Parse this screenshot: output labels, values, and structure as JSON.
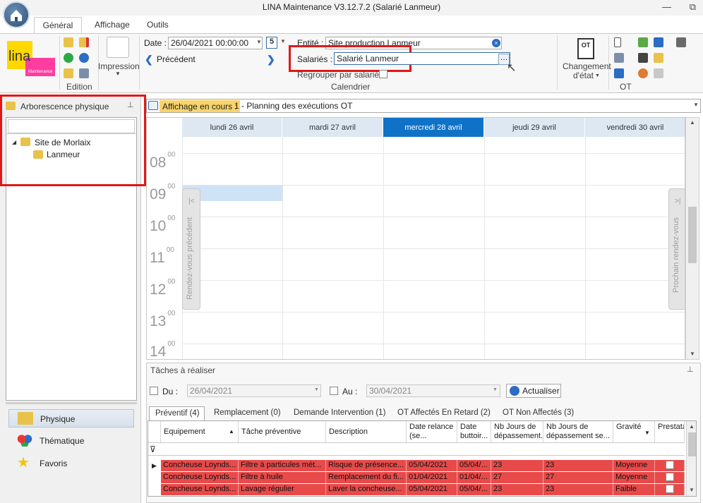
{
  "window": {
    "title": "LINA Maintenance  V3.12.7.2  (Salarié Lanmeur)",
    "minimize": "—",
    "restore": "⧉"
  },
  "tabs": [
    "Général",
    "Affichage",
    "Outils"
  ],
  "ribbon": {
    "edition_label": "Edition",
    "impression_label": "Impression",
    "date_label": "Date :",
    "date_value": "26/04/2021 00:00:00",
    "day_badge": "5",
    "precedent_label": "Précédent",
    "entite_label": "Entité :",
    "entite_value": "Site production Lanmeur",
    "salaries_label": "Salariés :",
    "salaries_value": "Salarié Lanmeur",
    "regrouper_label": "Regrouper par salarié",
    "calendrier_label": "Calendrier",
    "changement_label": "Changement",
    "etat_label": "d'état",
    "ot_label": "OT",
    "ot_icon": "OT"
  },
  "left": {
    "header": "Arborescence physique",
    "tree": [
      {
        "label": "Site de Morlaix"
      },
      {
        "label": "Lanmeur"
      }
    ],
    "nav": [
      {
        "label": "Physique"
      },
      {
        "label": "Thématique"
      },
      {
        "label": "Favoris"
      }
    ]
  },
  "main": {
    "affichage_label": "Affichage en cours :",
    "affichage_value": "1 - Planning des exécutions OT",
    "days": [
      "lundi 26 avril",
      "mardi 27 avril",
      "mercredi 28 avril",
      "jeudi 29 avril",
      "vendredi 30 avril"
    ],
    "hours": [
      "08",
      "09",
      "10",
      "11",
      "12",
      "13",
      "14"
    ],
    "minutes": "00",
    "prev_rdv": "Rendez-vous précédent",
    "next_rdv": "Prochain rendez-vous"
  },
  "tasks": {
    "title": "Tâches à réaliser",
    "du_label": "Du :",
    "du_value": "26/04/2021",
    "au_label": "Au :",
    "au_value": "30/04/2021",
    "actualiser": "Actualiser",
    "tabs": [
      "Préventif (4)",
      "Remplacement (0)",
      "Demande Intervention (1)",
      "OT Affectés En Retard (2)",
      "OT Non Affectés (3)"
    ],
    "columns": [
      "Equipement",
      "Tâche préventive",
      "Description",
      "Date relance (se...",
      "Date buttoir...",
      "Nb Jours de dépassement...",
      "Nb Jours de dépassement se...",
      "Gravité",
      "Prestataire"
    ],
    "rows": [
      [
        "Concheuse  Loynds...",
        "Filtre à particules mét...",
        "Risque de présence...",
        "05/04/2021",
        "05/04/...",
        "23",
        "23",
        "Moyenne"
      ],
      [
        "Concheuse  Loynds...",
        "Filtre à huile",
        "Remplacement du fi...",
        "01/04/2021",
        "01/04/...",
        "27",
        "27",
        "Moyenne"
      ],
      [
        "Concheuse  Loynds...",
        "Lavage régulier",
        "Laver la concheuse...",
        "05/04/2021",
        "05/04/...",
        "23",
        "23",
        "Faible"
      ]
    ]
  },
  "colors": {
    "accent": "#0f72c7",
    "highlight": "#e01818",
    "row": "#e84a4a",
    "today": "#0f72c7"
  }
}
